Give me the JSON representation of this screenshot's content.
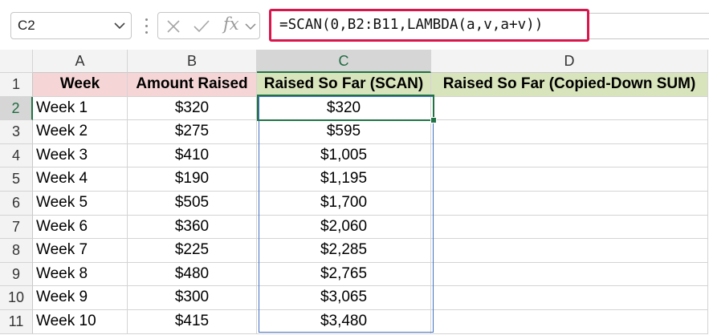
{
  "formula_bar": {
    "name_box": "C2",
    "fx_label": "fx",
    "formula": "=SCAN(0,B2:B11,LAMBDA(a,v,a+v))"
  },
  "columns": [
    "A",
    "B",
    "C",
    "D"
  ],
  "header_row": {
    "row_num": "1",
    "A": "Week",
    "B": "Amount Raised",
    "C": "Raised So Far (SCAN)",
    "D": "Raised So Far (Copied-Down SUM)"
  },
  "rows": [
    {
      "row_num": "2",
      "A": "Week 1",
      "B": "$320",
      "C": "$320",
      "D": ""
    },
    {
      "row_num": "3",
      "A": "Week 2",
      "B": "$275",
      "C": "$595",
      "D": ""
    },
    {
      "row_num": "4",
      "A": "Week 3",
      "B": "$410",
      "C": "$1,005",
      "D": ""
    },
    {
      "row_num": "5",
      "A": "Week 4",
      "B": "$190",
      "C": "$1,195",
      "D": ""
    },
    {
      "row_num": "6",
      "A": "Week 5",
      "B": "$505",
      "C": "$1,700",
      "D": ""
    },
    {
      "row_num": "7",
      "A": "Week 6",
      "B": "$360",
      "C": "$2,060",
      "D": ""
    },
    {
      "row_num": "8",
      "A": "Week 7",
      "B": "$225",
      "C": "$2,285",
      "D": ""
    },
    {
      "row_num": "9",
      "A": "Week 8",
      "B": "$480",
      "C": "$2,765",
      "D": ""
    },
    {
      "row_num": "10",
      "A": "Week 9",
      "B": "$300",
      "C": "$3,065",
      "D": ""
    },
    {
      "row_num": "11",
      "A": "Week 10",
      "B": "$415",
      "C": "$3,480",
      "D": ""
    }
  ],
  "selection": {
    "active_cell": "C2",
    "range": "C2:C11"
  },
  "icons": {
    "name_box_dropdown": "chevron-down-icon",
    "cancel": "close-icon",
    "enter": "check-icon",
    "insert_function": "fx-icon",
    "function_dropdown": "chevron-down-icon"
  },
  "colors": {
    "formula_highlight": "#d8164b",
    "header_pink": "#f5d5d5",
    "header_green": "#d8e4bc",
    "active_border": "#217346",
    "range_border": "#4472c4"
  }
}
